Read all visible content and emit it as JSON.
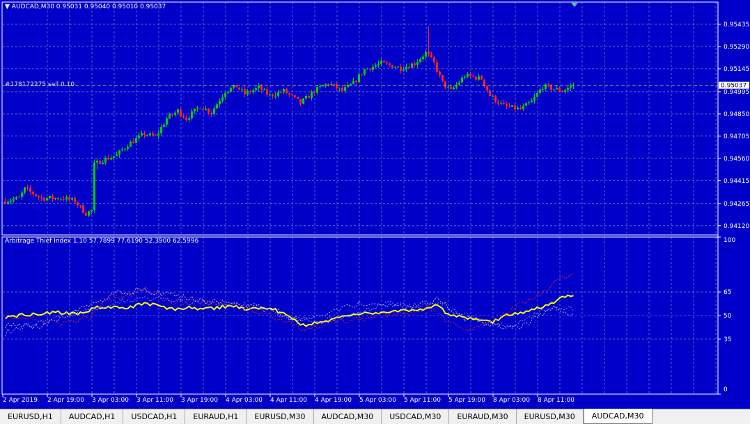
{
  "header": {
    "symbol_line": "AUDCAD,M30  0.95031 0.95040 0.95010 0.95037",
    "order_label": "#178172275 sell 0.10",
    "price_box": "0.95037"
  },
  "indicator": {
    "label": "Arbitrage Thief Index 1.10 57.7899 77.6190 52.3900 62.5996"
  },
  "colors": {
    "background": "#0000c8",
    "grid": "#9aa0d8",
    "bull": "#00d000",
    "bear": "#ff2020",
    "index_main": "#ffff00"
  },
  "chart_data": [
    {
      "type": "candlestick",
      "symbol": "AUDCAD",
      "timeframe": "M30",
      "ylim": [
        0.9406,
        0.9558
      ],
      "y_ticks": [
        "0.95435",
        "0.95290",
        "0.95145",
        "0.94995",
        "0.94850",
        "0.94705",
        "0.94560",
        "0.94415",
        "0.94265",
        "0.94120"
      ],
      "current_price": 0.95037,
      "x_labels": [
        "2 Apr 2019",
        "2 Apr 19:00",
        "3 Apr 03:00",
        "3 Apr 11:00",
        "3 Apr 19:00",
        "4 Apr 03:00",
        "4 Apr 11:00",
        "4 Apr 19:00",
        "5 Apr 03:00",
        "5 Apr 11:00",
        "5 Apr 19:00",
        "8 Apr 03:00",
        "8 Apr 11:00"
      ],
      "anchors": [
        [
          0,
          0.9428
        ],
        [
          6,
          0.943
        ],
        [
          8,
          0.9436
        ],
        [
          14,
          0.943
        ],
        [
          22,
          0.943
        ],
        [
          26,
          0.9428
        ],
        [
          30,
          0.942
        ],
        [
          32,
          0.9422
        ],
        [
          33,
          0.9452
        ],
        [
          36,
          0.9455
        ],
        [
          41,
          0.9458
        ],
        [
          45,
          0.9465
        ],
        [
          51,
          0.9472
        ],
        [
          55,
          0.947
        ],
        [
          59,
          0.9482
        ],
        [
          63,
          0.9487
        ],
        [
          66,
          0.9482
        ],
        [
          71,
          0.949
        ],
        [
          75,
          0.9486
        ],
        [
          80,
          0.95
        ],
        [
          84,
          0.9503
        ],
        [
          87,
          0.9498
        ],
        [
          92,
          0.9502
        ],
        [
          96,
          0.9497
        ],
        [
          101,
          0.95
        ],
        [
          107,
          0.9492
        ],
        [
          112,
          0.95
        ],
        [
          117,
          0.9505
        ],
        [
          122,
          0.95
        ],
        [
          126,
          0.9505
        ],
        [
          130,
          0.9514
        ],
        [
          136,
          0.9518
        ],
        [
          143,
          0.9515
        ],
        [
          148,
          0.9518
        ],
        [
          152,
          0.9525
        ],
        [
          155,
          0.9518
        ],
        [
          158,
          0.9505
        ],
        [
          161,
          0.95
        ],
        [
          166,
          0.951
        ],
        [
          172,
          0.9508
        ],
        [
          175,
          0.9497
        ],
        [
          180,
          0.949
        ],
        [
          186,
          0.9488
        ],
        [
          190,
          0.9493
        ],
        [
          194,
          0.9503
        ],
        [
          201,
          0.95
        ],
        [
          204,
          0.9503
        ]
      ],
      "bars": 205
    },
    {
      "type": "line",
      "name": "Arbitrage Thief Index 1.10",
      "ylim": [
        0,
        100
      ],
      "y_ticks": [
        100,
        65,
        50,
        35,
        0
      ],
      "values": [
        57.7899,
        77.619,
        52.39,
        62.5996
      ],
      "series": [
        {
          "color": "#ffff00",
          "anchors": [
            [
              0,
              49
            ],
            [
              10,
              51
            ],
            [
              18,
              52
            ],
            [
              25,
              51
            ],
            [
              33,
              55
            ],
            [
              45,
              55
            ],
            [
              50,
              58
            ],
            [
              55,
              56
            ],
            [
              60,
              54
            ],
            [
              65,
              55
            ],
            [
              72,
              54
            ],
            [
              80,
              56
            ],
            [
              88,
              54
            ],
            [
              95,
              55
            ],
            [
              100,
              51
            ],
            [
              107,
              44
            ],
            [
              115,
              46
            ],
            [
              121,
              50
            ],
            [
              127,
              51
            ],
            [
              135,
              52
            ],
            [
              142,
              53
            ],
            [
              150,
              54
            ],
            [
              155,
              56
            ],
            [
              160,
              50
            ],
            [
              170,
              48
            ],
            [
              175,
              46
            ],
            [
              180,
              50
            ],
            [
              190,
              54
            ],
            [
              195,
              57
            ],
            [
              199,
              61
            ],
            [
              202,
              63
            ],
            [
              204,
              62
            ]
          ]
        },
        {
          "color": "#ff2020",
          "anchors": [
            [
              0,
              50
            ],
            [
              10,
              47
            ],
            [
              20,
              45
            ],
            [
              30,
              48
            ],
            [
              36,
              60
            ],
            [
              45,
              64
            ],
            [
              50,
              67
            ],
            [
              55,
              62
            ],
            [
              60,
              58
            ],
            [
              68,
              60
            ],
            [
              80,
              58
            ],
            [
              90,
              53
            ],
            [
              100,
              46
            ],
            [
              107,
              41
            ],
            [
              115,
              45
            ],
            [
              125,
              48
            ],
            [
              135,
              50
            ],
            [
              145,
              52
            ],
            [
              152,
              55
            ],
            [
              158,
              48
            ],
            [
              165,
              42
            ],
            [
              175,
              45
            ],
            [
              183,
              55
            ],
            [
              190,
              62
            ],
            [
              197,
              70
            ],
            [
              204,
              78
            ]
          ]
        },
        {
          "color": "#d0d0d0",
          "anchors": [
            [
              0,
              44
            ],
            [
              12,
              43
            ],
            [
              22,
              50
            ],
            [
              32,
              58
            ],
            [
              40,
              65
            ],
            [
              50,
              66
            ],
            [
              58,
              64
            ],
            [
              65,
              61
            ],
            [
              75,
              59
            ],
            [
              85,
              57
            ],
            [
              95,
              55
            ],
            [
              105,
              47
            ],
            [
              115,
              50
            ],
            [
              125,
              57
            ],
            [
              135,
              58
            ],
            [
              145,
              55
            ],
            [
              155,
              60
            ],
            [
              165,
              48
            ],
            [
              175,
              44
            ],
            [
              185,
              42
            ],
            [
              192,
              50
            ],
            [
              198,
              55
            ],
            [
              204,
              51
            ]
          ]
        },
        {
          "color": "#9090ff",
          "anchors": [
            [
              0,
              39
            ],
            [
              8,
              44
            ],
            [
              16,
              47
            ],
            [
              28,
              53
            ],
            [
              38,
              57
            ],
            [
              46,
              61
            ],
            [
              55,
              60
            ],
            [
              63,
              59
            ],
            [
              72,
              58
            ],
            [
              80,
              57
            ],
            [
              90,
              56
            ],
            [
              100,
              49
            ],
            [
              110,
              46
            ],
            [
              118,
              48
            ],
            [
              128,
              52
            ],
            [
              138,
              58
            ],
            [
              148,
              56
            ],
            [
              156,
              58
            ],
            [
              163,
              51
            ],
            [
              172,
              46
            ],
            [
              182,
              43
            ],
            [
              190,
              51
            ],
            [
              197,
              55
            ],
            [
              204,
              54
            ]
          ]
        }
      ]
    }
  ],
  "tabs": [
    {
      "label": "EURUSD,H1",
      "active": false
    },
    {
      "label": "AUDCAD,H1",
      "active": false
    },
    {
      "label": "USDCAD,H1",
      "active": false
    },
    {
      "label": "EURAUD,H1",
      "active": false
    },
    {
      "label": "EURUSD,M30",
      "active": false
    },
    {
      "label": "AUDCAD,M30",
      "active": false
    },
    {
      "label": "USDCAD,M30",
      "active": false
    },
    {
      "label": "EURAUD,M30",
      "active": false
    },
    {
      "label": "EURUSD,M30",
      "active": false
    },
    {
      "label": "AUDCAD,M30",
      "active": true
    }
  ]
}
